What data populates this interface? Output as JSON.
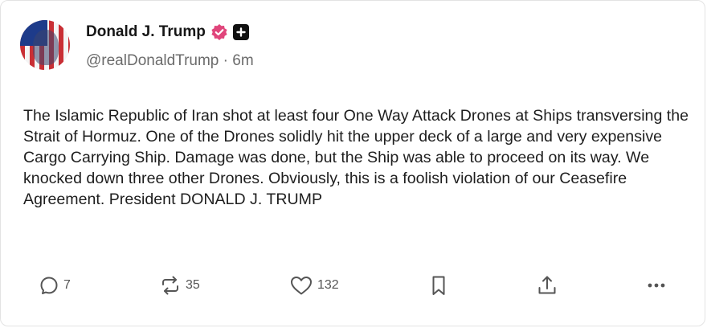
{
  "author": {
    "display_name": "Donald J. Trump",
    "handle": "@realDonaldTrump",
    "separator": "·",
    "time_ago": "6m",
    "verified_badge_color": "#e0457b"
  },
  "post": {
    "text": "The Islamic Republic of Iran shot at least four One Way Attack Drones at Ships transversing the Strait of Hormuz. One of the Drones solidly hit the upper deck of a large and very expensive Cargo Carrying Ship. Damage was done, but the Ship was able to proceed on its way. We knocked down three other Drones. Obviously, this is a foolish violation of our Ceasefire Agreement. President DONALD J. TRUMP"
  },
  "actions": {
    "reply_count": "7",
    "repost_count": "35",
    "like_count": "132",
    "icons": [
      "reply-icon",
      "repost-icon",
      "like-icon",
      "bookmark-icon",
      "share-icon",
      "more-icon"
    ]
  }
}
